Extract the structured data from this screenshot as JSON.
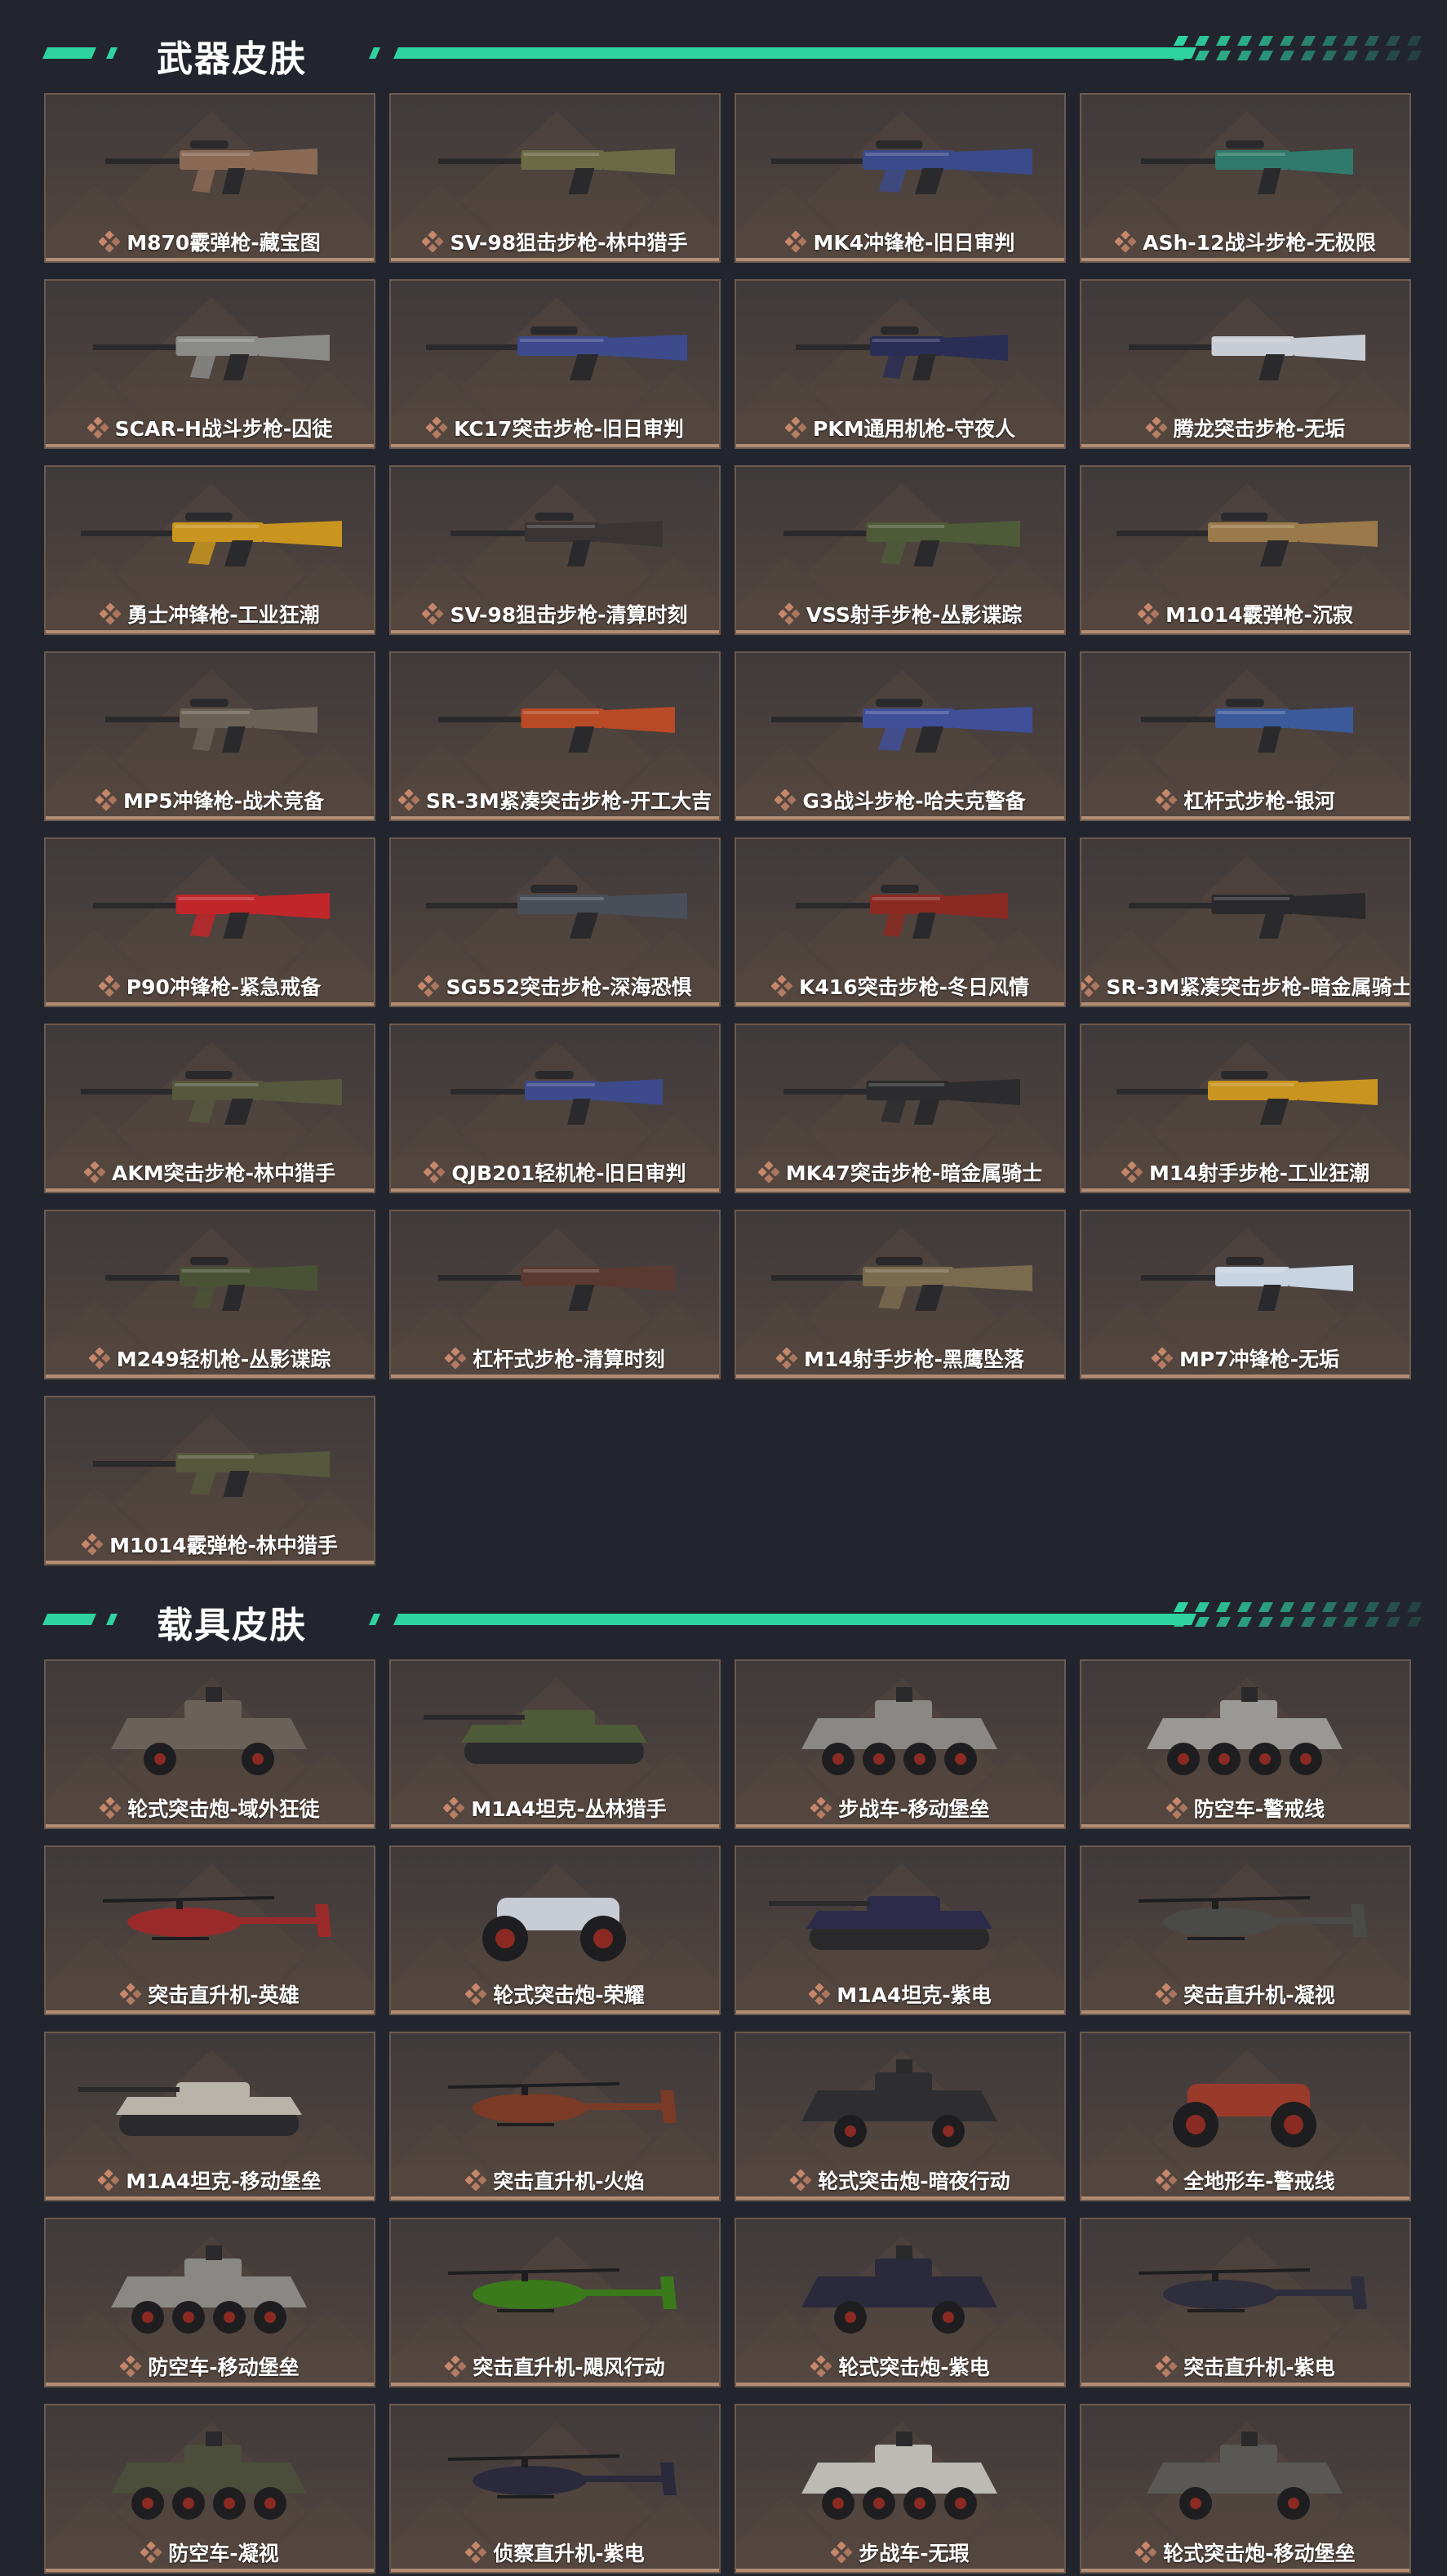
{
  "sections": [
    {
      "title": "武器皮肤",
      "kind": "weapon",
      "items": [
        {
          "label": "M870霰弹枪-藏宝图",
          "icon": "shotgun-icon",
          "color": "#8a6a55"
        },
        {
          "label": "SV-98狙击步枪-林中猎手",
          "icon": "sniper-rifle-icon",
          "color": "#6b6a45"
        },
        {
          "label": "MK4冲锋枪-旧日审判",
          "icon": "smg-icon",
          "color": "#3b4a8a"
        },
        {
          "label": "ASh-12战斗步枪-无极限",
          "icon": "battle-rifle-icon",
          "color": "#2f7a6a"
        },
        {
          "label": "SCAR-H战斗步枪-囚徒",
          "icon": "battle-rifle-icon",
          "color": "#8a8a88"
        },
        {
          "label": "KC17突击步枪-旧日审判",
          "icon": "assault-rifle-icon",
          "color": "#3d4a8c"
        },
        {
          "label": "PKM通用机枪-守夜人",
          "icon": "machine-gun-icon",
          "color": "#2a2e55"
        },
        {
          "label": "腾龙突击步枪-无垢",
          "icon": "assault-rifle-icon",
          "color": "#c8ccd4"
        },
        {
          "label": "勇士冲锋枪-工业狂潮",
          "icon": "smg-icon",
          "color": "#c9951f"
        },
        {
          "label": "SV-98狙击步枪-清算时刻",
          "icon": "sniper-rifle-icon",
          "color": "#3a3434"
        },
        {
          "label": "VSS射手步枪-丛影谍踪",
          "icon": "marksman-rifle-icon",
          "color": "#4e5a38"
        },
        {
          "label": "M1014霰弹枪-沉寂",
          "icon": "shotgun-icon",
          "color": "#9a7a4a"
        },
        {
          "label": "MP5冲锋枪-战术竞备",
          "icon": "smg-icon",
          "color": "#6a6256"
        },
        {
          "label": "SR-3M紧凑突击步枪-开工大吉",
          "icon": "assault-rifle-icon",
          "color": "#b84a26"
        },
        {
          "label": "G3战斗步枪-哈夫克警备",
          "icon": "battle-rifle-icon",
          "color": "#3f4f9a"
        },
        {
          "label": "杠杆式步枪-银河",
          "icon": "lever-rifle-icon",
          "color": "#3c5a9a"
        },
        {
          "label": "P90冲锋枪-紧急戒备",
          "icon": "smg-icon",
          "color": "#c0262a"
        },
        {
          "label": "SG552突击步枪-深海恐惧",
          "icon": "assault-rifle-icon",
          "color": "#4a4e58"
        },
        {
          "label": "K416突击步枪-冬日风情",
          "icon": "assault-rifle-icon",
          "color": "#8a2a22"
        },
        {
          "label": "SR-3M紧凑突击步枪-暗金属骑士",
          "icon": "assault-rifle-icon",
          "color": "#2a2a2c"
        },
        {
          "label": "AKM突击步枪-林中猎手",
          "icon": "assault-rifle-icon",
          "color": "#55583c"
        },
        {
          "label": "QJB201轻机枪-旧日审判",
          "icon": "light-machine-gun-icon",
          "color": "#3d4a8c"
        },
        {
          "label": "MK47突击步枪-暗金属骑士",
          "icon": "assault-rifle-icon",
          "color": "#2c2c2e"
        },
        {
          "label": "M14射手步枪-工业狂潮",
          "icon": "marksman-rifle-icon",
          "color": "#c9951f"
        },
        {
          "label": "M249轻机枪-丛影谍踪",
          "icon": "light-machine-gun-icon",
          "color": "#4a5236"
        },
        {
          "label": "杠杆式步枪-清算时刻",
          "icon": "lever-rifle-icon",
          "color": "#5a3a30"
        },
        {
          "label": "M14射手步枪-黑鹰坠落",
          "icon": "marksman-rifle-icon",
          "color": "#7a6a4e"
        },
        {
          "label": "MP7冲锋枪-无垢",
          "icon": "smg-icon",
          "color": "#c8d4e2"
        },
        {
          "label": "M1014霰弹枪-林中猎手",
          "icon": "shotgun-icon",
          "color": "#55583c"
        }
      ]
    },
    {
      "title": "载具皮肤",
      "kind": "vehicle",
      "items": [
        {
          "label": "轮式突击炮-域外狂徒",
          "icon": "armored-car-icon",
          "color": "#6a625a"
        },
        {
          "label": "M1A4坦克-丛林猎手",
          "icon": "tank-icon",
          "color": "#4e5a38"
        },
        {
          "label": "步战车-移动堡垒",
          "icon": "ifv-icon",
          "color": "#8a8884"
        },
        {
          "label": "防空车-警戒线",
          "icon": "ifv-icon",
          "color": "#9a9894"
        },
        {
          "label": "突击直升机-英雄",
          "icon": "helicopter-icon",
          "color": "#9a2a2a"
        },
        {
          "label": "轮式突击炮-荣耀",
          "icon": "buggy-icon",
          "color": "#c8ccd4"
        },
        {
          "label": "M1A4坦克-紫电",
          "icon": "tank-icon",
          "color": "#2c2c4a"
        },
        {
          "label": "突击直升机-凝视",
          "icon": "helicopter-icon",
          "color": "#4a4a48"
        },
        {
          "label": "M1A4坦克-移动堡垒",
          "icon": "tank-icon",
          "color": "#b8b4aa"
        },
        {
          "label": "突击直升机-火焰",
          "icon": "helicopter-icon",
          "color": "#7a3a26"
        },
        {
          "label": "轮式突击炮-暗夜行动",
          "icon": "armored-car-icon",
          "color": "#2e2e30"
        },
        {
          "label": "全地形车-警戒线",
          "icon": "atv-icon",
          "color": "#9a3a2a"
        },
        {
          "label": "防空车-移动堡垒",
          "icon": "ifv-icon",
          "color": "#8a8884"
        },
        {
          "label": "突击直升机-飓风行动",
          "icon": "helicopter-icon",
          "color": "#3a7a1a"
        },
        {
          "label": "轮式突击炮-紫电",
          "icon": "armored-car-icon",
          "color": "#2a2a3c"
        },
        {
          "label": "突击直升机-紫电",
          "icon": "helicopter-icon",
          "color": "#2e2e3c"
        },
        {
          "label": "防空车-凝视",
          "icon": "ifv-icon",
          "color": "#4a4e3a"
        },
        {
          "label": "侦察直升机-紫电",
          "icon": "scout-helicopter-icon",
          "color": "#2a2a3c"
        },
        {
          "label": "步战车-无瑕",
          "icon": "ifv-icon",
          "color": "#bcbab4"
        },
        {
          "label": "轮式突击炮-移动堡垒",
          "icon": "armored-car-icon",
          "color": "#5a5854"
        }
      ]
    }
  ],
  "colors": {
    "background": "#23252e",
    "accent": "#2fd3a0",
    "card_border": "#6b5a4e",
    "label_icon": "#c7876a"
  }
}
